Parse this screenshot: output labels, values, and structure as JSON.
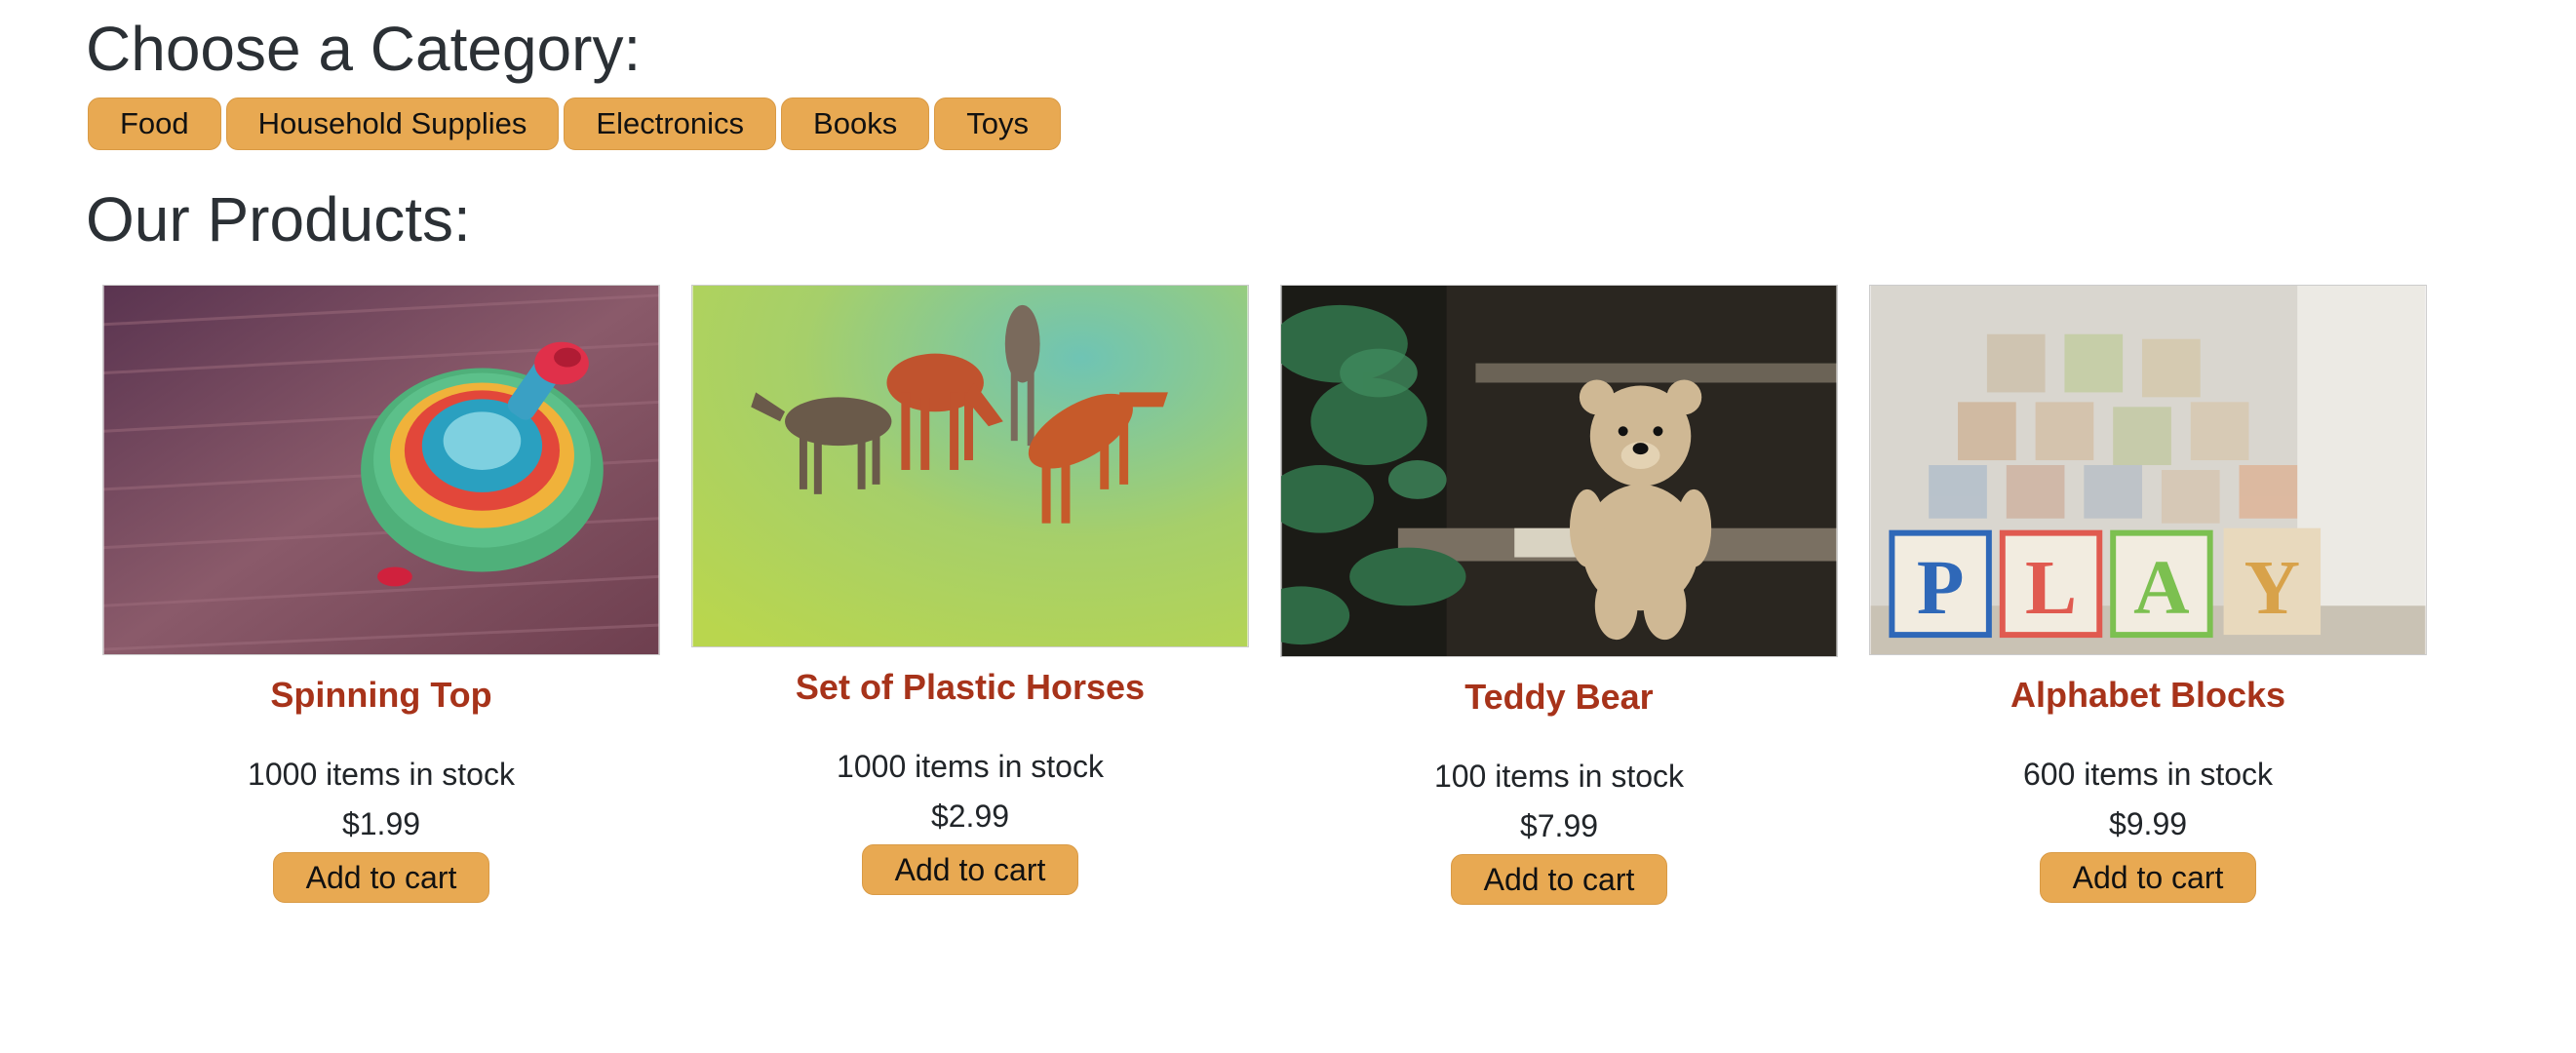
{
  "headings": {
    "category": "Choose a Category:",
    "products": "Our Products:"
  },
  "categories": [
    "Food",
    "Household Supplies",
    "Electronics",
    "Books",
    "Toys"
  ],
  "products": [
    {
      "name": "Spinning Top",
      "stock": "1000 items in stock",
      "price": "$1.99",
      "button": "Add to cart",
      "image": "spinning-top-photo"
    },
    {
      "name": "Set of Plastic Horses",
      "stock": "1000 items in stock",
      "price": "$2.99",
      "button": "Add to cart",
      "image": "plastic-horses-photo"
    },
    {
      "name": "Teddy Bear",
      "stock": "100 items in stock",
      "price": "$7.99",
      "button": "Add to cart",
      "image": "teddy-bear-photo"
    },
    {
      "name": "Alphabet Blocks",
      "stock": "600 items in stock",
      "price": "$9.99",
      "button": "Add to cart",
      "image": "alphabet-blocks-photo"
    }
  ],
  "colors": {
    "button_fill": "#e8a952",
    "product_name": "#a7331a",
    "text": "#212529"
  }
}
